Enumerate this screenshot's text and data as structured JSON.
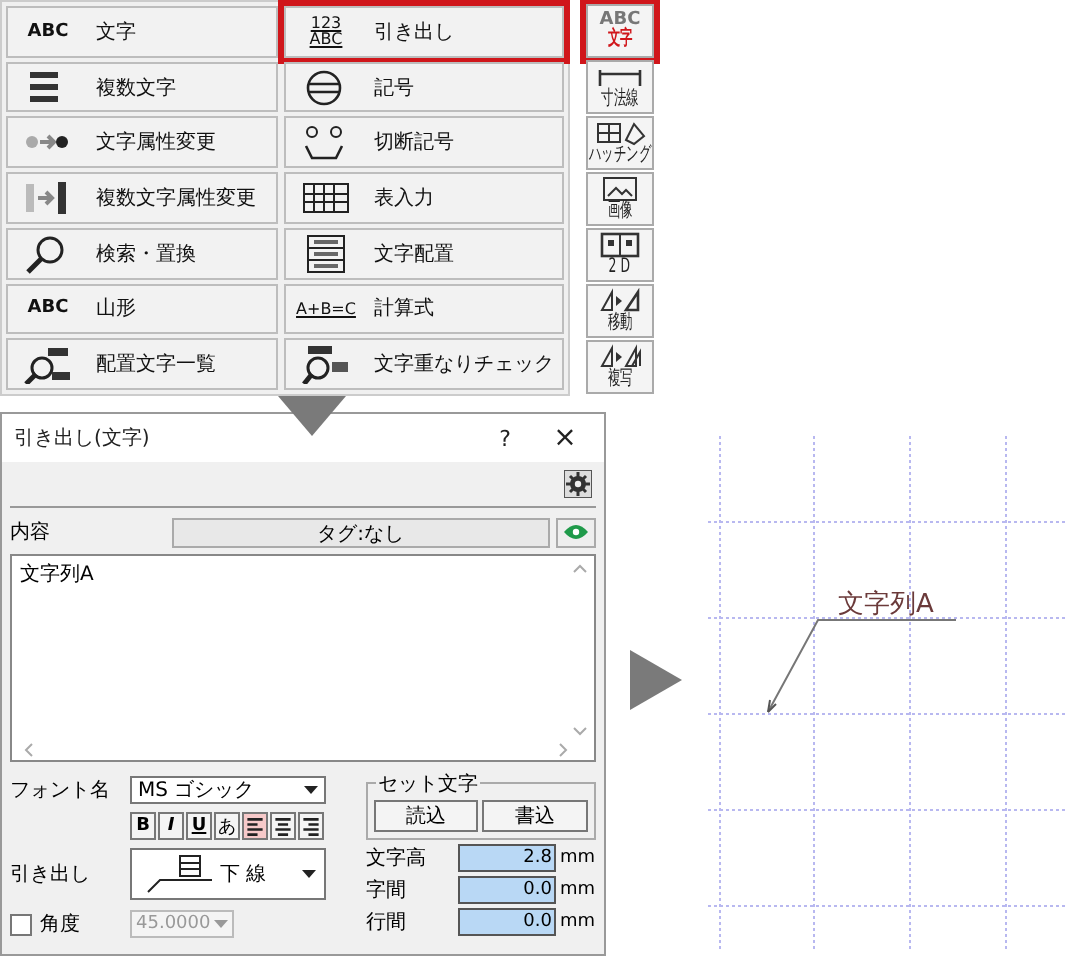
{
  "menu": {
    "left_items": [
      {
        "label": "文字",
        "icon_text": "ABC",
        "selected": false
      },
      {
        "label": "複数文字",
        "selected": false
      },
      {
        "label": "文字属性変更",
        "selected": false
      },
      {
        "label": "複数文字属性変更",
        "selected": false
      },
      {
        "label": "検索・置換",
        "selected": false
      },
      {
        "label": "山形",
        "icon_text": "ABC",
        "selected": false
      },
      {
        "label": "配置文字一覧",
        "selected": false
      }
    ],
    "right_items": [
      {
        "label": "引き出し",
        "icon_text": "123\nABC",
        "selected": true
      },
      {
        "label": "記号",
        "selected": false
      },
      {
        "label": "切断記号",
        "selected": false
      },
      {
        "label": "表入力",
        "selected": false
      },
      {
        "label": "文字配置",
        "selected": false
      },
      {
        "label": "計算式",
        "icon_text": "A+B=C",
        "selected": false
      },
      {
        "label": "文字重なりチェック",
        "selected": false
      }
    ]
  },
  "side_toolbar": [
    {
      "label": "文字",
      "icon_text": "ABC",
      "selected": true
    },
    {
      "label": "寸法線",
      "selected": false
    },
    {
      "label": "ハッチング",
      "selected": false
    },
    {
      "label": "画像",
      "selected": false
    },
    {
      "label": "2 D",
      "selected": false
    },
    {
      "label": "移動",
      "selected": false
    },
    {
      "label": "複写",
      "selected": false
    }
  ],
  "dialog": {
    "title": "引き出し(文字)",
    "help": "?",
    "close": "×",
    "content_label": "内容",
    "tag_button": "タグ:なし",
    "text_value": "文字列A",
    "font_label": "フォント名",
    "font_value": "MS ゴシック",
    "style_buttons": [
      {
        "label": "B",
        "selected": false
      },
      {
        "label": "I",
        "selected": false
      },
      {
        "label": "U",
        "selected": false
      },
      {
        "label": "あ",
        "selected": false
      }
    ],
    "align_buttons": [
      {
        "selected": true
      },
      {
        "selected": false
      },
      {
        "selected": false
      }
    ],
    "leader_label": "引き出し",
    "leader_value": "下 線",
    "angle": {
      "label": "角度",
      "checked": false,
      "value": "45.0000",
      "disabled": true
    },
    "set_group": {
      "title": "セット文字",
      "buttons": [
        "読込",
        "書込"
      ]
    },
    "metrics": [
      {
        "label": "文字高",
        "value": "2.8",
        "unit": "mm"
      },
      {
        "label": "字間",
        "value": "0.0",
        "unit": "mm"
      },
      {
        "label": "行間",
        "value": "0.0",
        "unit": "mm"
      }
    ]
  },
  "canvas": {
    "text": "文字列A"
  }
}
